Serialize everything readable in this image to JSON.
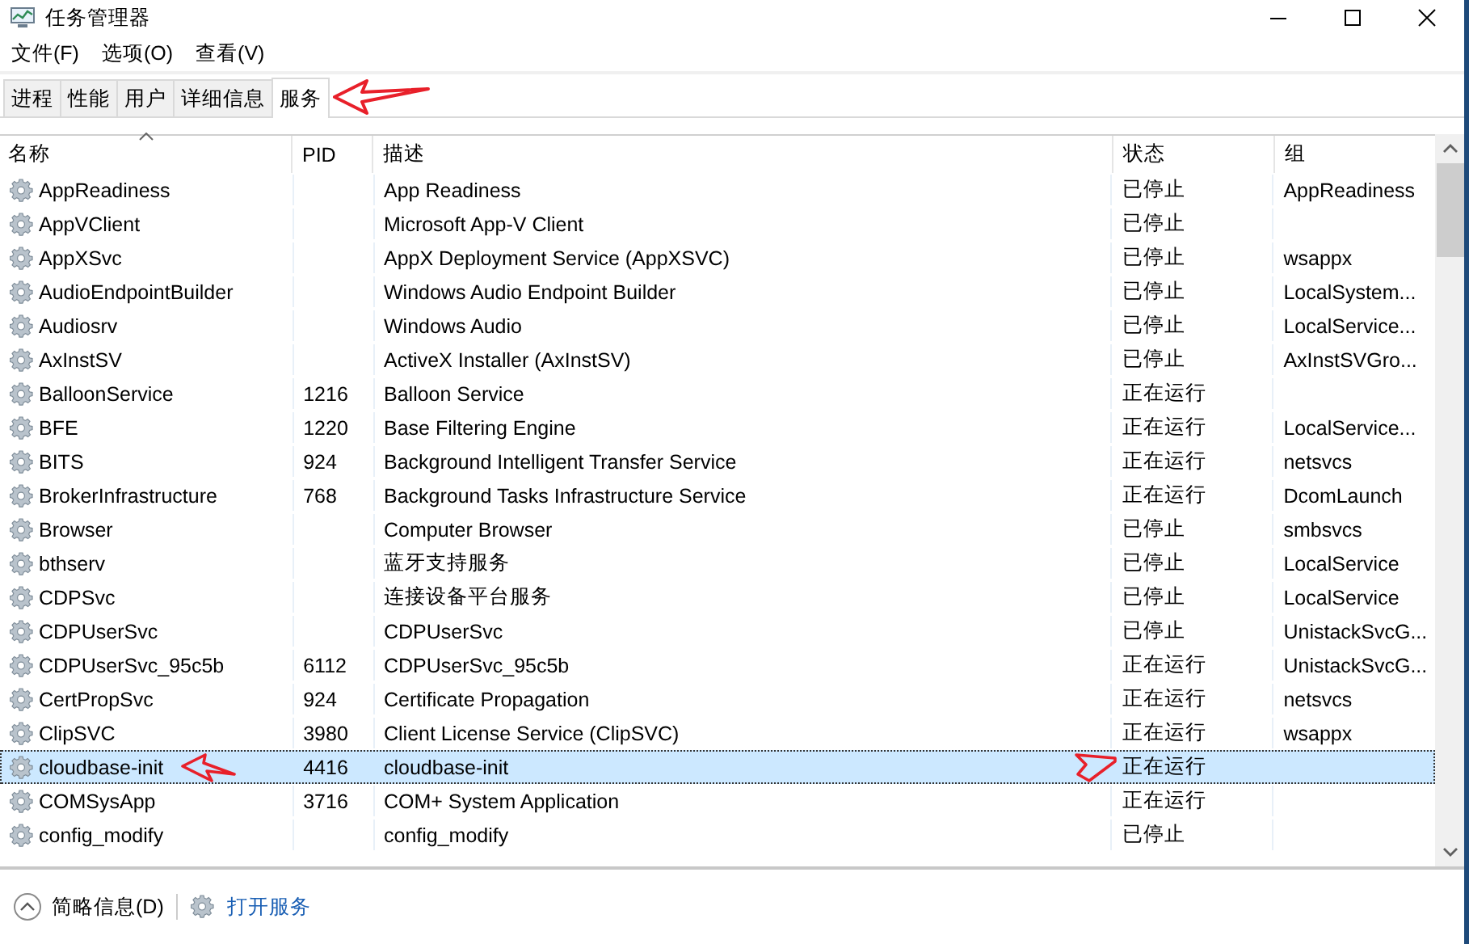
{
  "window": {
    "title": "任务管理器"
  },
  "menu": [
    "文件(F)",
    "选项(O)",
    "查看(V)"
  ],
  "tabs": [
    {
      "label": "进程",
      "selected": false,
      "marked": false
    },
    {
      "label": "性能",
      "selected": false,
      "marked": false
    },
    {
      "label": "用户",
      "selected": false,
      "marked": false
    },
    {
      "label": "详细信息",
      "selected": false,
      "marked": false
    },
    {
      "label": "服务",
      "selected": true,
      "marked": true
    }
  ],
  "table": {
    "columns": [
      "名称",
      "PID",
      "描述",
      "状态",
      "组"
    ],
    "rows": [
      {
        "name": "AppReadiness",
        "pid": "",
        "description": "App Readiness",
        "status": "已停止",
        "group": "AppReadiness",
        "selected": false,
        "marked": false
      },
      {
        "name": "AppVClient",
        "pid": "",
        "description": "Microsoft App-V Client",
        "status": "已停止",
        "group": "",
        "selected": false,
        "marked": false
      },
      {
        "name": "AppXSvc",
        "pid": "",
        "description": "AppX Deployment Service (AppXSVC)",
        "status": "已停止",
        "group": "wsappx",
        "selected": false,
        "marked": false
      },
      {
        "name": "AudioEndpointBuilder",
        "pid": "",
        "description": "Windows Audio Endpoint Builder",
        "status": "已停止",
        "group": "LocalSystem...",
        "selected": false,
        "marked": false
      },
      {
        "name": "Audiosrv",
        "pid": "",
        "description": "Windows Audio",
        "status": "已停止",
        "group": "LocalService...",
        "selected": false,
        "marked": false
      },
      {
        "name": "AxInstSV",
        "pid": "",
        "description": "ActiveX Installer (AxInstSV)",
        "status": "已停止",
        "group": "AxInstSVGro...",
        "selected": false,
        "marked": false
      },
      {
        "name": "BalloonService",
        "pid": "1216",
        "description": "Balloon Service",
        "status": "正在运行",
        "group": "",
        "selected": false,
        "marked": false
      },
      {
        "name": "BFE",
        "pid": "1220",
        "description": "Base Filtering Engine",
        "status": "正在运行",
        "group": "LocalService...",
        "selected": false,
        "marked": false
      },
      {
        "name": "BITS",
        "pid": "924",
        "description": "Background Intelligent Transfer Service",
        "status": "正在运行",
        "group": "netsvcs",
        "selected": false,
        "marked": false
      },
      {
        "name": "BrokerInfrastructure",
        "pid": "768",
        "description": "Background Tasks Infrastructure Service",
        "status": "正在运行",
        "group": "DcomLaunch",
        "selected": false,
        "marked": false
      },
      {
        "name": "Browser",
        "pid": "",
        "description": "Computer Browser",
        "status": "已停止",
        "group": "smbsvcs",
        "selected": false,
        "marked": false
      },
      {
        "name": "bthserv",
        "pid": "",
        "description": "蓝牙支持服务",
        "status": "已停止",
        "group": "LocalService",
        "selected": false,
        "marked": false
      },
      {
        "name": "CDPSvc",
        "pid": "",
        "description": "连接设备平台服务",
        "status": "已停止",
        "group": "LocalService",
        "selected": false,
        "marked": false
      },
      {
        "name": "CDPUserSvc",
        "pid": "",
        "description": "CDPUserSvc",
        "status": "已停止",
        "group": "UnistackSvcG...",
        "selected": false,
        "marked": false
      },
      {
        "name": "CDPUserSvc_95c5b",
        "pid": "6112",
        "description": "CDPUserSvc_95c5b",
        "status": "正在运行",
        "group": "UnistackSvcG...",
        "selected": false,
        "marked": false
      },
      {
        "name": "CertPropSvc",
        "pid": "924",
        "description": "Certificate Propagation",
        "status": "正在运行",
        "group": "netsvcs",
        "selected": false,
        "marked": false
      },
      {
        "name": "ClipSVC",
        "pid": "3980",
        "description": "Client License Service (ClipSVC)",
        "status": "正在运行",
        "group": "wsappx",
        "selected": false,
        "marked": false
      },
      {
        "name": "cloudbase-init",
        "pid": "4416",
        "description": "cloudbase-init",
        "status": "正在运行",
        "group": "",
        "selected": true,
        "marked": true
      },
      {
        "name": "COMSysApp",
        "pid": "3716",
        "description": "COM+ System Application",
        "status": "正在运行",
        "group": "",
        "selected": false,
        "marked": false
      },
      {
        "name": "config_modify",
        "pid": "",
        "description": "config_modify",
        "status": "已停止",
        "group": "",
        "selected": false,
        "marked": false
      }
    ]
  },
  "footer": {
    "details_toggle": "简略信息(D)",
    "open_services": "打开服务"
  }
}
